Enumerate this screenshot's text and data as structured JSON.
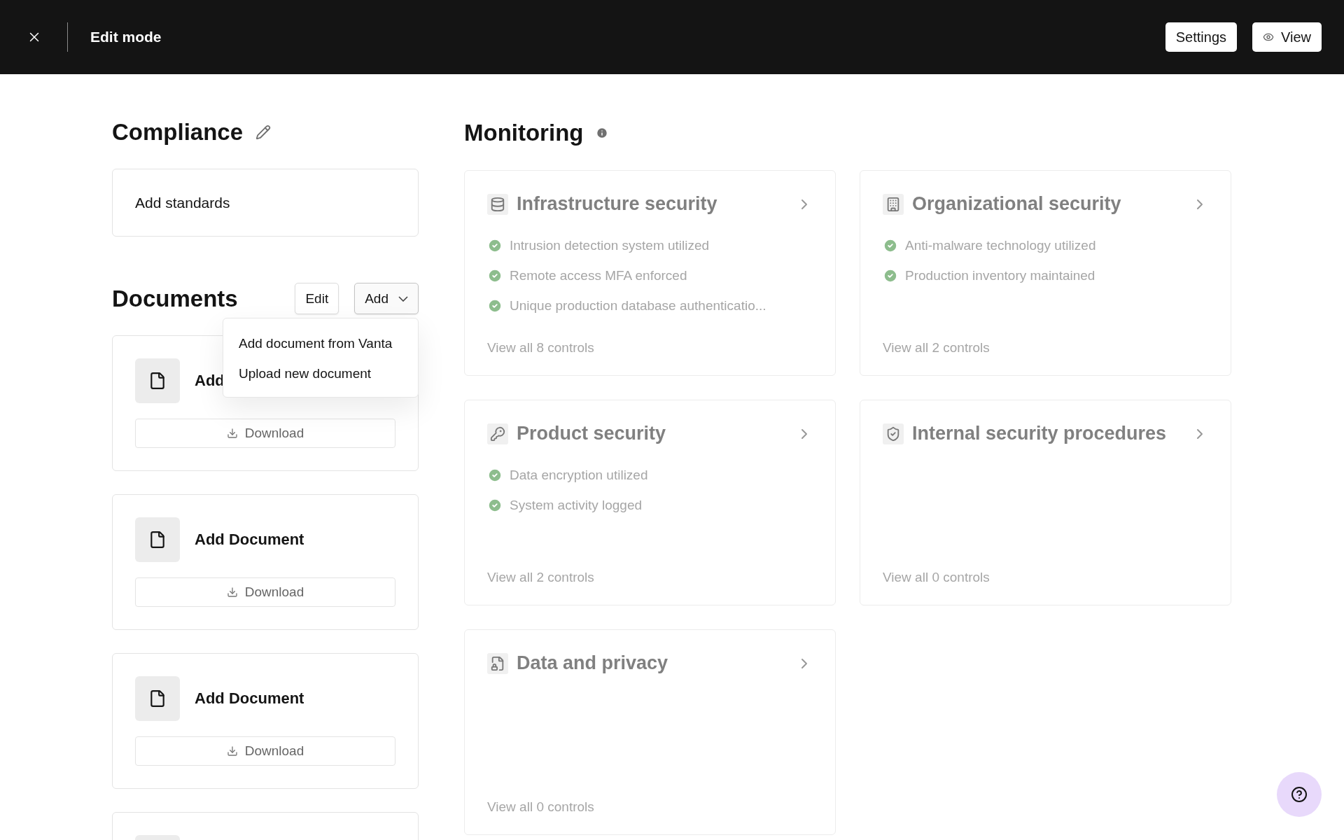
{
  "top_bar": {
    "title": "Edit mode",
    "buttons": [
      {
        "label": "Settings",
        "kind": "plain"
      },
      {
        "label": "View",
        "kind": "view"
      }
    ]
  },
  "compliance": {
    "title": "Compliance",
    "standards": "Add standards"
  },
  "documents": {
    "title": "Documents",
    "edit_label": "Edit",
    "add_label": "Add",
    "expanded": true,
    "menu": [
      "Add document from Vanta",
      "Upload new document"
    ],
    "cards": [
      {
        "kind": "full",
        "title": "Add",
        "download": "Download"
      },
      {
        "kind": "full",
        "title": "Add Document",
        "download": "Download"
      },
      {
        "kind": "full",
        "title": "Add Document",
        "download": "Download"
      },
      {
        "kind": "cut"
      }
    ]
  },
  "monitoring": {
    "title": "Monitoring",
    "cards": [
      {
        "title": "Infrastructure security",
        "items": [
          "Intrusion detection system utilized",
          "Remote access MFA enforced",
          "Unique production database authenticatio..."
        ],
        "footer": "View all 8 controls"
      },
      {
        "title": "Organizational security",
        "items": [
          "Anti-malware technology utilized",
          "Production inventory maintained"
        ],
        "footer": "View all 2 controls"
      },
      {
        "title": "Product security",
        "items": [
          "Data encryption utilized",
          "System activity logged"
        ],
        "footer": "View all 2 controls"
      },
      {
        "title": "Internal security procedures",
        "footer": "View all 0 controls"
      },
      {
        "title": "Data and privacy",
        "footer": "View all 0 controls"
      }
    ]
  }
}
